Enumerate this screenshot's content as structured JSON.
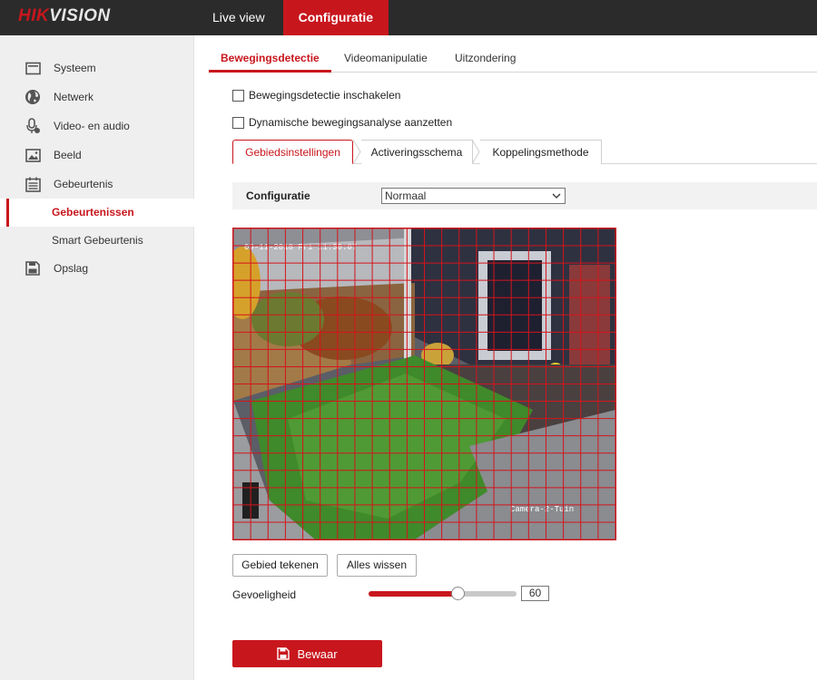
{
  "header": {
    "logo_red": "HIK",
    "logo_rest": "VISION",
    "nav": [
      {
        "label": "Live view"
      },
      {
        "label": "Configuratie"
      }
    ],
    "active_nav": "Configuratie"
  },
  "sidebar": {
    "items": [
      {
        "label": "Systeem",
        "icon": "monitor-icon"
      },
      {
        "label": "Netwerk",
        "icon": "globe-icon"
      },
      {
        "label": "Video- en audio",
        "icon": "microphone-icon"
      },
      {
        "label": "Beeld",
        "icon": "image-icon"
      },
      {
        "label": "Gebeurtenis",
        "icon": "calendar-icon"
      }
    ],
    "subitems": [
      {
        "label": "Gebeurtenissen",
        "active": true
      },
      {
        "label": "Smart Gebeurtenis",
        "active": false
      }
    ],
    "bottom_item": {
      "label": "Opslag",
      "icon": "storage-icon"
    }
  },
  "tabs": [
    {
      "label": "Bewegingsdetectie",
      "active": true
    },
    {
      "label": "Videomanipulatie",
      "active": false
    },
    {
      "label": "Uitzondering",
      "active": false
    }
  ],
  "checkboxes": [
    {
      "label": "Bewegingsdetectie inschakelen",
      "checked": false
    },
    {
      "label": "Dynamische bewegingsanalyse aanzetten",
      "checked": false
    }
  ],
  "subtabs": [
    {
      "label": "Gebiedsinstellingen",
      "active": true
    },
    {
      "label": "Activeringsschema",
      "active": false
    },
    {
      "label": "Koppelingsmethode",
      "active": false
    }
  ],
  "config": {
    "label": "Configuratie",
    "selected": "Normaal"
  },
  "video": {
    "timestamp": "09-11-2018 Fri 11:30:07",
    "camera_name": "Camera-2-Tuin",
    "grid_color": "#d4141c"
  },
  "buttons": {
    "draw_area": "Gebied tekenen",
    "clear_all": "Alles wissen",
    "save": "Bewaar"
  },
  "sensitivity": {
    "label": "Gevoeligheid",
    "value": "60",
    "fraction": 0.6
  },
  "colors": {
    "brand": "#c8161d",
    "topbar": "#2b2b2b",
    "sidebar": "#efefef"
  }
}
